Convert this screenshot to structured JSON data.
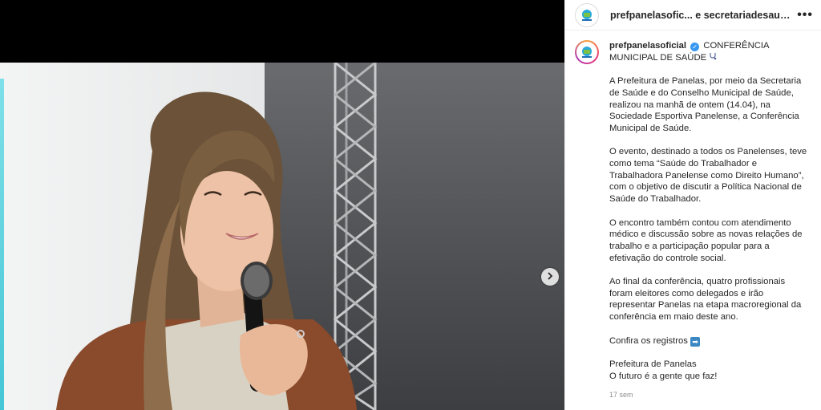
{
  "header": {
    "account_primary": "prefpanelasofic...",
    "account_secondary": "e secretariadesaudepane...",
    "more_label": "•••"
  },
  "post": {
    "username": "prefpanelasoficial",
    "title": "CONFERÊNCIA MUNICIPAL DE SAÚDE",
    "paragraphs": [
      "A Prefeitura de Panelas, por meio da Secretaria de Saúde e do Conselho Municipal de Saúde, realizou na manhã de ontem (14.04), na Sociedade Esportiva Panelense, a Conferência Municipal de Saúde.",
      "O evento, destinado a todos os Panelenses, teve como tema “Saúde do Trabalhador e Trabalhadora Panelense como Direito Humano”, com o objetivo de discutir a Política Nacional de Saúde do Trabalhador.",
      "O encontro também contou com atendimento médico e discussão sobre as novas relações de trabalho e a participação popular para a efetivação do controle social.",
      "Ao final da conferência, quatro profissionais foram eleitores como delegados e irão representar Panelas na etapa macroregional da conferência em maio deste ano."
    ],
    "cta": "Confira os registros",
    "signature_line1": "Prefeitura de Panelas",
    "signature_line2": "O futuro é a gente que faz!",
    "timestamp": "17 sem"
  },
  "icons": {
    "verified": "verified-badge-icon",
    "stethoscope": "stethoscope-icon",
    "arrow_right": "right-arrow-emoji-icon",
    "next": "chevron-right-icon",
    "more": "more-horizontal-icon"
  },
  "colors": {
    "verified_blue": "#3897f0",
    "story_ring": "#e8397a",
    "muted_text": "#8e8e8e"
  }
}
